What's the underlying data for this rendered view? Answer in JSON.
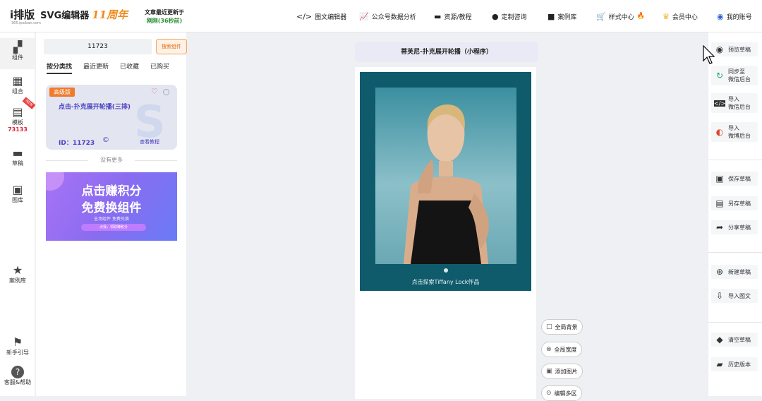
{
  "brand": {
    "logo": "i排版",
    "logo_sub": "365.ipaiban.com",
    "product": "SVG编辑器",
    "anniversary": "11周年"
  },
  "news": {
    "line1": "文章最近更新于",
    "line2": "刚刚(36秒前)"
  },
  "nav": [
    {
      "icon": "code-icon",
      "label": "图文编辑器"
    },
    {
      "icon": "chart-icon",
      "label": "公众号数据分析"
    },
    {
      "icon": "folder-icon",
      "label": "资源/教程"
    },
    {
      "icon": "headset-icon",
      "label": "定制咨询"
    },
    {
      "icon": "book-icon",
      "label": "案例库"
    },
    {
      "icon": "cart-icon",
      "label": "样式中心"
    },
    {
      "icon": "crown-icon",
      "label": "会员中心"
    },
    {
      "icon": "user-icon",
      "label": "我的账号"
    }
  ],
  "left_rail": [
    {
      "icon": "puzzle-icon",
      "label": "组件"
    },
    {
      "icon": "grid-icon",
      "label": "组合"
    },
    {
      "icon": "template-icon",
      "label": "模板",
      "count": "73133",
      "badge": "NEW"
    },
    {
      "icon": "folder-icon",
      "label": "草稿"
    },
    {
      "icon": "image-icon",
      "label": "图库"
    },
    {
      "icon": "star-icon",
      "label": "案例库"
    },
    {
      "icon": "guide-icon",
      "label": "新手引导"
    },
    {
      "icon": "help-icon",
      "label": "客服&帮助"
    }
  ],
  "panel": {
    "search_value": "11723",
    "search_button": "搜索组件",
    "tabs": [
      "按分类找",
      "最近更新",
      "已收藏",
      "已购买"
    ],
    "card": {
      "badge": "高级版",
      "title": "点击-扑克展开轮播(三排)",
      "id": "ID：11723",
      "tutorial": "查看教程"
    },
    "no_more": "没有更多",
    "banner": {
      "line1": "点击赚积分",
      "line2": "免费换组件",
      "line3": "全场组件 免费兑换",
      "button": "点我，领取赚积分"
    }
  },
  "canvas": {
    "doc_title": "蒂芙尼-扑克展开轮播（小程序）",
    "photo_caption": "点击探索Tiffany Lock作品"
  },
  "float_buttons": [
    "全局背景",
    "全局宽度",
    "添加图片",
    "编辑多区"
  ],
  "right_rail": {
    "group1": [
      "预览草稿",
      "同步至\n微信后台",
      "导入\n微信后台",
      "导入\n微博后台"
    ],
    "group2": [
      "保存草稿",
      "另存草稿",
      "分享草稿"
    ],
    "group3": [
      "新建草稿",
      "导入图文"
    ],
    "group4": [
      "清空草稿",
      "历史版本"
    ]
  },
  "colors": {
    "accent": "#4a3fc2",
    "brand_orange": "#f08a1a",
    "count_red": "#d7263d",
    "photo_bg": "#0f5b6c"
  }
}
